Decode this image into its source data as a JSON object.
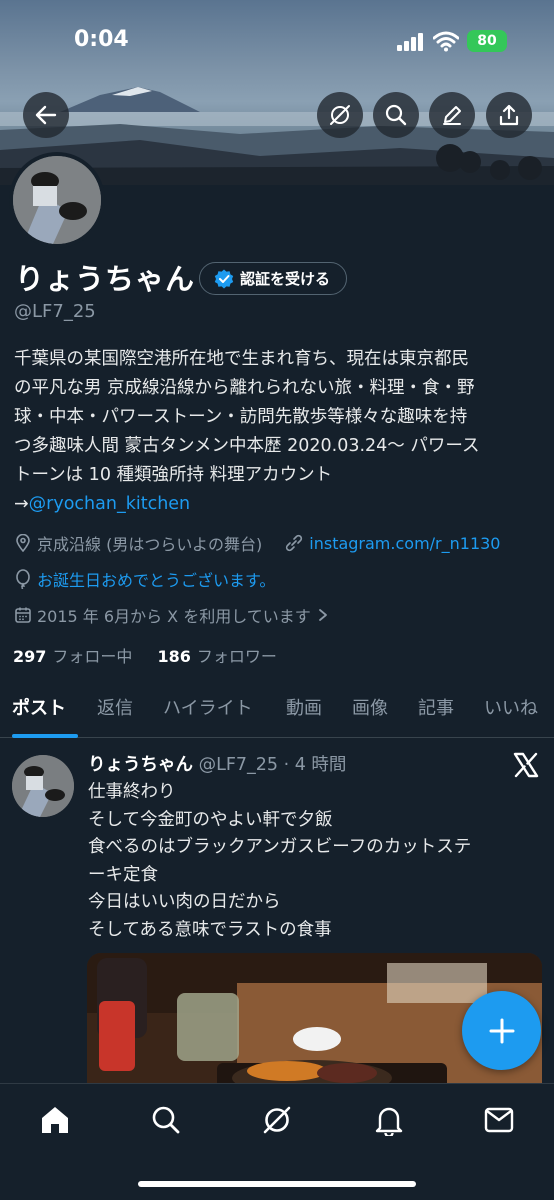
{
  "status_bar": {
    "time": "0:04",
    "battery": "80"
  },
  "profile": {
    "name": "りょうちゃん",
    "verify_button": "認証を受ける",
    "handle": "@LF7_25",
    "bio_lines": [
      "千葉県の某国際空港所在地で生まれ育ち、現在は東京都民",
      "の平凡な男 京成線沿線から離れられない旅・料理・食・野",
      "球・中本・パワーストーン・訪問先散歩等様々な趣味を持",
      "つ多趣味人間 蒙古タンメン中本歴 2020.03.24～ パワース",
      "トーンは 10 種類強所持 料理アカウント"
    ],
    "bio_arrow": "→",
    "bio_link": "@ryochan_kitchen",
    "location": "京成沿線 (男はつらいよの舞台)",
    "website": "instagram.com/r_n1130",
    "birthday": "お誕生日おめでとうございます。",
    "joined": "2015 年 6月から X を利用しています",
    "following_count": "297",
    "following_label": "フォロー中",
    "followers_count": "186",
    "followers_label": "フォロワー"
  },
  "tabs": [
    "ポスト",
    "返信",
    "ハイライト",
    "動画",
    "画像",
    "記事",
    "いいね"
  ],
  "post": {
    "name": "りょうちゃん",
    "meta": "@LF7_25 · 4 時間",
    "lines": [
      "仕事終わり",
      "そして今金町のやよい軒で夕飯",
      "食べるのはブラックアンガスビーフのカットステ",
      "ーキ定食",
      "今日はいい肉の日だから",
      "そしてある意味でラストの食事"
    ]
  },
  "icons": {
    "back": "arrow-left-icon",
    "grok": "grok-icon",
    "search": "search-icon",
    "edit": "pencil-icon",
    "share": "share-icon"
  },
  "colors": {
    "accent": "#1d9bf0",
    "background": "#15202b",
    "battery": "#34c759"
  }
}
